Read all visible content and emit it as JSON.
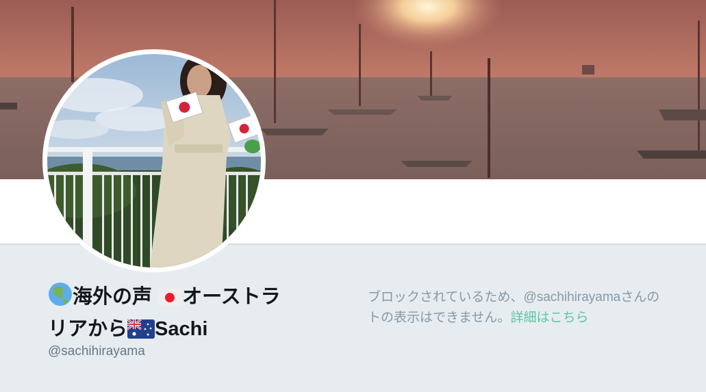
{
  "profile": {
    "name_part1": "海外の声",
    "name_part2": "オーストラ",
    "name_part3": "リアから",
    "name_part4": "Sachi",
    "handle": "@sachihirayama"
  },
  "blocked": {
    "line1_prefix": "ブロックされているため、",
    "line1_handle": "@sachihirayama",
    "line1_suffix": "さんの",
    "line2_text": "トの表示はできません。",
    "learn_more": "詳細はこちら"
  },
  "icons": {
    "globe": "globe-asia-icon",
    "japan_flag": "japan-flag-icon",
    "australia_flag": "australia-flag-icon"
  },
  "colors": {
    "background": "#e6ecf0",
    "name": "#14171a",
    "handle": "#657786",
    "muted": "#8899a6",
    "link": "#5cc7a0"
  }
}
